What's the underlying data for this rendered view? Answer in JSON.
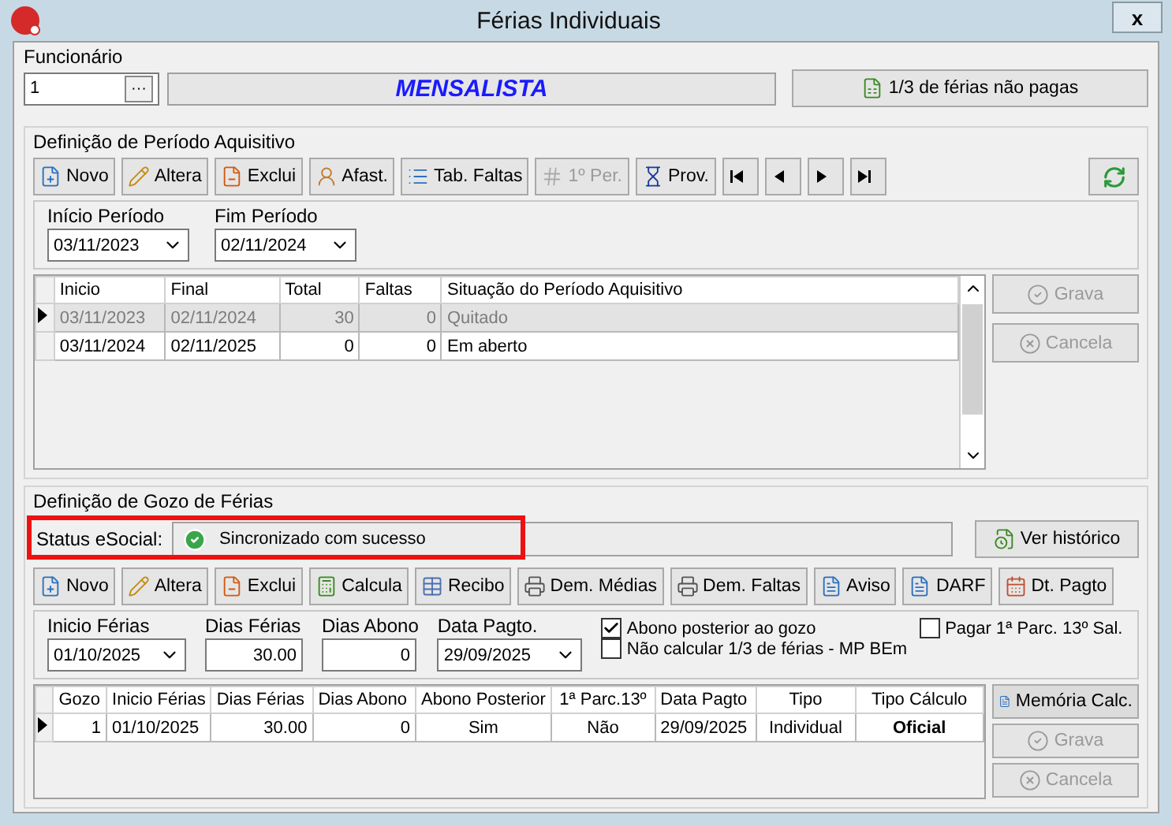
{
  "window": {
    "title": "Férias Individuais",
    "close": "x"
  },
  "employee": {
    "label": "Funcionário",
    "code": "1",
    "lookup": "···",
    "name": "MENSALISTA",
    "unpaid_button": "1/3 de férias não pagas"
  },
  "period": {
    "title": "Definição de Período Aquisitivo",
    "toolbar": [
      {
        "label": "Novo",
        "disabled": false
      },
      {
        "label": "Altera",
        "disabled": false
      },
      {
        "label": "Exclui",
        "disabled": false
      },
      {
        "label": "Afast.",
        "disabled": false
      },
      {
        "label": "Tab. Faltas",
        "disabled": false
      },
      {
        "label": "1º Per.",
        "disabled": true
      },
      {
        "label": "Prov.",
        "disabled": false
      }
    ],
    "start": {
      "label": "Início Período",
      "value": "03/11/2023"
    },
    "end": {
      "label": "Fim Período",
      "value": "02/11/2024"
    },
    "columns": [
      "Inicio",
      "Final",
      "Total",
      "Faltas",
      "Situação do Período Aquisitivo"
    ],
    "rows": [
      {
        "cells": [
          "03/11/2023",
          "02/11/2024",
          "30",
          "0",
          "Quitado"
        ],
        "selected": true
      },
      {
        "cells": [
          "03/11/2024",
          "02/11/2025",
          "0",
          "0",
          "Em aberto"
        ],
        "selected": false
      }
    ],
    "side_buttons": [
      {
        "label": "Grava",
        "disabled": true
      },
      {
        "label": "Cancela",
        "disabled": true
      }
    ]
  },
  "vacation": {
    "title": "Definição de Gozo de Férias",
    "status": {
      "label": "Status eSocial:",
      "value": "Sincronizado com sucesso",
      "highlighted": true
    },
    "history_button": "Ver histórico",
    "toolbar": [
      {
        "label": "Novo",
        "disabled": false
      },
      {
        "label": "Altera",
        "disabled": false
      },
      {
        "label": "Exclui",
        "disabled": false
      },
      {
        "label": "Calcula",
        "disabled": false
      },
      {
        "label": "Recibo",
        "disabled": false
      },
      {
        "label": "Dem. Médias",
        "disabled": false
      },
      {
        "label": "Dem. Faltas",
        "disabled": false
      },
      {
        "label": "Aviso",
        "disabled": false
      },
      {
        "label": "DARF",
        "disabled": false
      },
      {
        "label": "Dt. Pagto",
        "disabled": false
      }
    ],
    "start": {
      "label": "Inicio Férias",
      "value": "01/10/2025"
    },
    "days": {
      "label": "Dias Férias",
      "value": "30.00"
    },
    "bonus_days": {
      "label": "Dias Abono",
      "value": "0"
    },
    "pay_date": {
      "label": "Data Pagto.",
      "value": "29/09/2025"
    },
    "checkboxes": [
      {
        "label": "Abono posterior ao gozo",
        "checked": true
      },
      {
        "label": "Pagar 1ª Parc. 13º Sal.",
        "checked": false
      },
      {
        "label": "Não calcular 1/3 de férias - MP BEm",
        "checked": false
      }
    ],
    "columns": [
      "Gozo",
      "Inicio Férias",
      "Dias Férias",
      "Dias Abono",
      "Abono Posterior",
      "1ª Parc.13º",
      "Data Pagto",
      "Tipo",
      "Tipo Cálculo"
    ],
    "rows": [
      {
        "cells": [
          "1",
          "01/10/2025",
          "30.00",
          "0",
          "Sim",
          "Não",
          "29/09/2025",
          "Individual",
          "Oficial"
        ],
        "selected": true
      }
    ],
    "side_buttons": [
      {
        "label": "Memória Calc.",
        "disabled": false
      },
      {
        "label": "Grava",
        "disabled": true
      },
      {
        "label": "Cancela",
        "disabled": true
      }
    ]
  }
}
